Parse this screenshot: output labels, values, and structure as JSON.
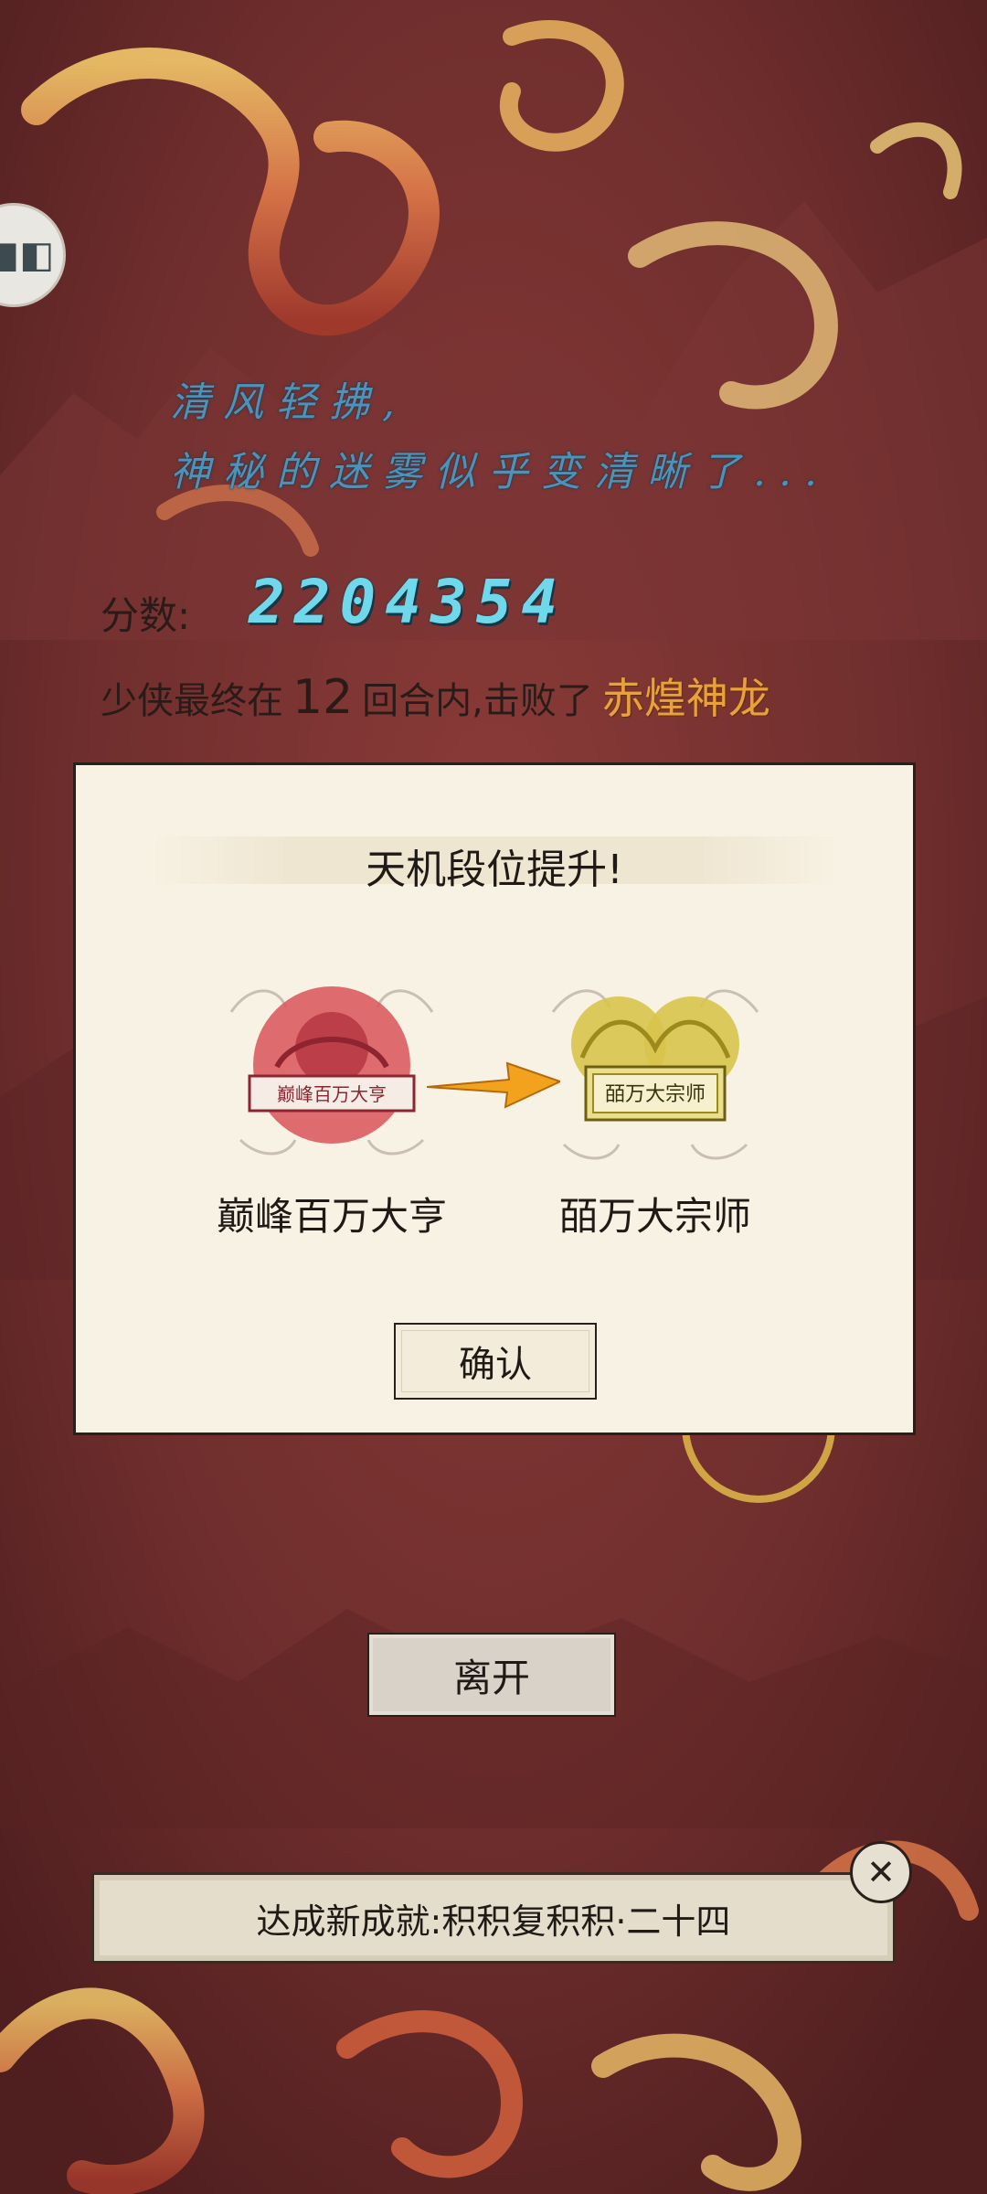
{
  "header": {
    "poem_line_1": "清风轻拂,",
    "poem_line_2": "神秘的迷雾似乎变清晰了..."
  },
  "score": {
    "label": "分数:",
    "value": "2204354"
  },
  "result": {
    "prefix": "少侠最终在",
    "rounds": "12",
    "middle": "回合内,击败了",
    "boss": "赤煌神龙"
  },
  "dialog": {
    "title": "天机段位提升!",
    "from_rank": {
      "name": "巅峰百万大亨",
      "emblem_text": "巅峰百万大亨",
      "color": "#d9555a"
    },
    "to_rank": {
      "name": "皕万大宗师",
      "emblem_text": "皕万大宗师",
      "color": "#d8c44b"
    },
    "confirm_label": "确认"
  },
  "leave_label": "离开",
  "achievement": {
    "text": "达成新成就:积积复积积·二十四",
    "close_icon": "close-icon"
  },
  "colors": {
    "background": "#6e2d2d",
    "score_accent": "#6fd8ea",
    "boss_accent": "#e9a23a",
    "paper": "#f8f2e4"
  }
}
